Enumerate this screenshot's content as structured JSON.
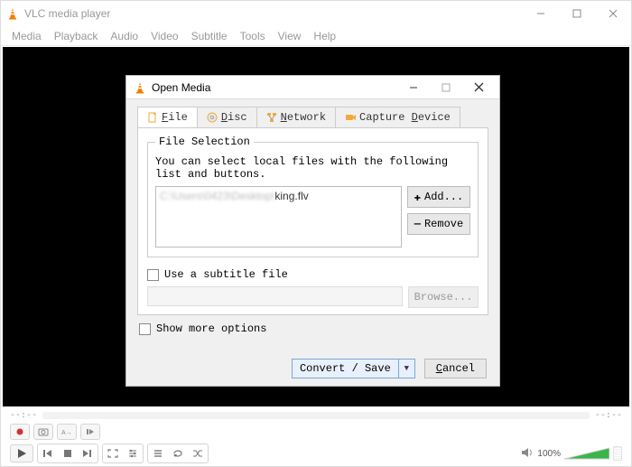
{
  "app": {
    "title": "VLC media player"
  },
  "menu": {
    "items": [
      "Media",
      "Playback",
      "Audio",
      "Video",
      "Subtitle",
      "Tools",
      "View",
      "Help"
    ]
  },
  "seek": {
    "left": "--:--",
    "right": "--:--"
  },
  "volume": {
    "label": "100%"
  },
  "dialog": {
    "title": "Open Media",
    "tabs": {
      "file": {
        "label": "File",
        "accel": "F"
      },
      "disc": {
        "label": "Disc",
        "accel": "D"
      },
      "network": {
        "label": "Network",
        "accel": "N"
      },
      "capture": {
        "label": "Capture Device",
        "accel": "D"
      }
    },
    "file_selection": {
      "legend": "File Selection",
      "hint": "You can select local files with the following list and buttons.",
      "list": {
        "prefix": "C:\\Users\\0423\\Desktop\\",
        "filename": "king.flv"
      },
      "add_label": "Add...",
      "remove_label": "Remove"
    },
    "subtitle": {
      "label": "Use a subtitle file",
      "browse": "Browse..."
    },
    "more": {
      "label": "Show more options",
      "accel": "m"
    },
    "footer": {
      "convert": "Convert / Save",
      "cancel": "Cancel",
      "cancel_accel": "C"
    }
  }
}
